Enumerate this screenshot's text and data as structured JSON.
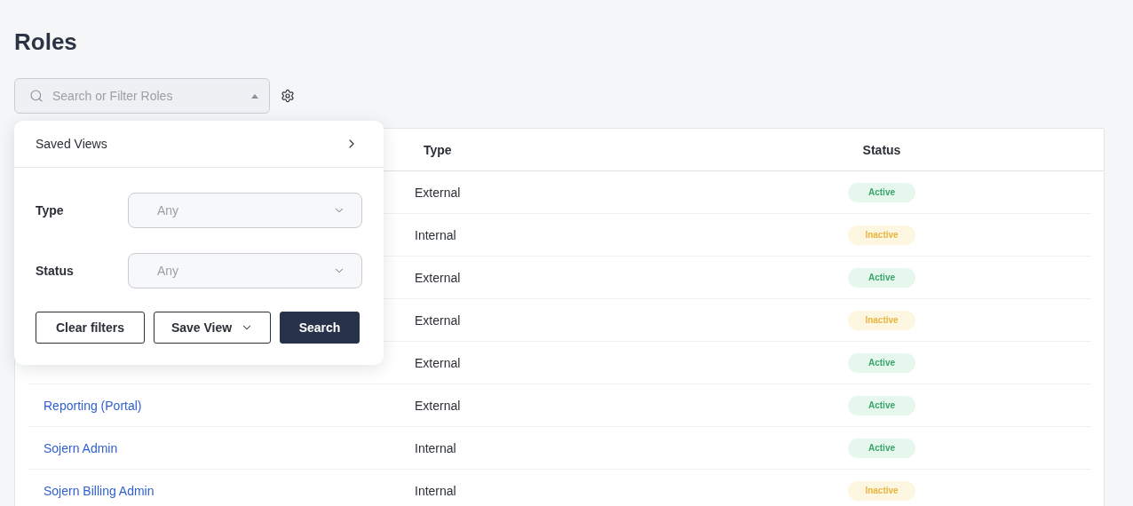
{
  "page": {
    "title": "Roles"
  },
  "search": {
    "placeholder": "Search or Filter Roles"
  },
  "filter_panel": {
    "saved_views": "Saved Views",
    "filters": [
      {
        "label": "Type",
        "placeholder": "Any"
      },
      {
        "label": "Status",
        "placeholder": "Any"
      }
    ],
    "buttons": [
      {
        "label": "Clear filters",
        "kind": "outline"
      },
      {
        "label": "Save View",
        "kind": "dropdown"
      },
      {
        "label": "Search",
        "kind": "primary"
      }
    ]
  },
  "table": {
    "columns": [
      "Type",
      "Status"
    ],
    "rows": [
      {
        "type": "External",
        "status": {
          "label": "Active",
          "active": true
        }
      },
      {
        "type": "Internal",
        "status": {
          "label": "Inactive",
          "active": false
        }
      },
      {
        "type": "External",
        "status": {
          "label": "Active",
          "active": true
        }
      },
      {
        "type": "External",
        "status": {
          "label": "Inactive",
          "active": false
        }
      },
      {
        "type": "External",
        "status": {
          "label": "Active",
          "active": true
        }
      },
      {
        "name": "Reporting (Portal)",
        "type": "External",
        "status": {
          "label": "Active",
          "active": true
        }
      },
      {
        "name": "Sojern Admin",
        "type": "Internal",
        "status": {
          "label": "Active",
          "active": true
        }
      },
      {
        "name": "Sojern Billing Admin",
        "type": "Internal",
        "status": {
          "label": "Inactive",
          "active": false
        }
      }
    ]
  }
}
